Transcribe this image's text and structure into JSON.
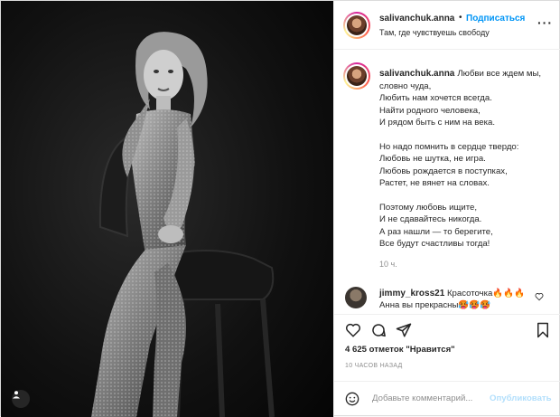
{
  "post": {
    "username": "salivanchuk.anna",
    "follow_label": "Подписаться",
    "dot": "•",
    "location": "Там, где чувствуешь свободу",
    "caption": {
      "username": "salivanchuk.anna",
      "first_line": "Любви все ждем мы, словно чуда,",
      "stanza1": [
        "Любить нам хочется всегда.",
        "Найти родного человека,",
        "И рядом быть с ним на века."
      ],
      "stanza2": [
        "Но надо помнить в сердце твердо:",
        "Любовь не шутка, не игра.",
        "Любовь рождается в поступках,",
        "Растет, не вянет на словах."
      ],
      "stanza3": [
        "Поэтому любовь ищите,",
        "И не сдавайтесь никогда.",
        "А раз нашли — то берегите,",
        "Все будут счастливы тогда!"
      ],
      "time": "10 ч."
    },
    "comment": {
      "username": "jimmy_kross21",
      "text": "Красоточка🔥🔥🔥Анна вы прекрасны🥵🥵🥵"
    },
    "likes": "4 625 отметок \"Нравится\"",
    "posted_ago": "10 ЧАСОВ НАЗАД",
    "add_comment": {
      "placeholder": "Добавьте комментарий...",
      "publish_label": "Опубликовать"
    }
  },
  "icons": {
    "more": "more-options-icon",
    "heart": "heart-icon",
    "comment": "comment-icon",
    "share": "share-icon",
    "save": "bookmark-icon",
    "emoji": "emoji-icon",
    "user_tag": "user-tag-icon"
  },
  "colors": {
    "accent": "#0095f6",
    "publish_disabled": "#b2dffc",
    "muted": "#8e8e8e",
    "text": "#262626"
  }
}
